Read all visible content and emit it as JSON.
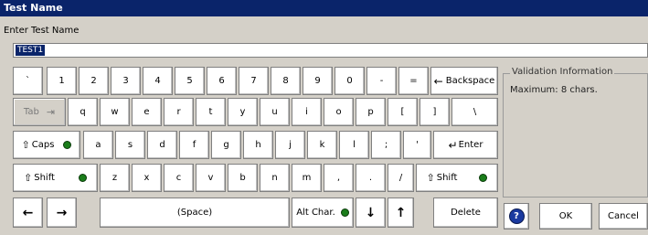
{
  "window": {
    "title": "Test Name"
  },
  "prompt": "Enter Test Name",
  "input": {
    "value": "TEST1"
  },
  "keys": {
    "row1": [
      "`",
      "1",
      "2",
      "3",
      "4",
      "5",
      "6",
      "7",
      "8",
      "9",
      "0",
      "-",
      "="
    ],
    "backspace": "Backspace",
    "tab": "Tab",
    "row2": [
      "q",
      "w",
      "e",
      "r",
      "t",
      "y",
      "u",
      "i",
      "o",
      "p",
      "[",
      "]",
      "\\"
    ],
    "caps": "Caps",
    "row3": [
      "a",
      "s",
      "d",
      "f",
      "g",
      "h",
      "j",
      "k",
      "l",
      ";",
      "'"
    ],
    "enter": "Enter",
    "shift_left": "Shift",
    "row4": [
      "z",
      "x",
      "c",
      "v",
      "b",
      "n",
      "m",
      ",",
      ".",
      "/"
    ],
    "shift_right": "Shift",
    "space": "(Space)",
    "alt_char": "Alt Char.",
    "delete": "Delete"
  },
  "validation": {
    "title": "Validation Information",
    "text": "Maximum:  8 chars."
  },
  "buttons": {
    "ok": "OK",
    "cancel": "Cancel"
  },
  "colors": {
    "led": "#1a7d1a",
    "title_bar": "#0a246a"
  }
}
